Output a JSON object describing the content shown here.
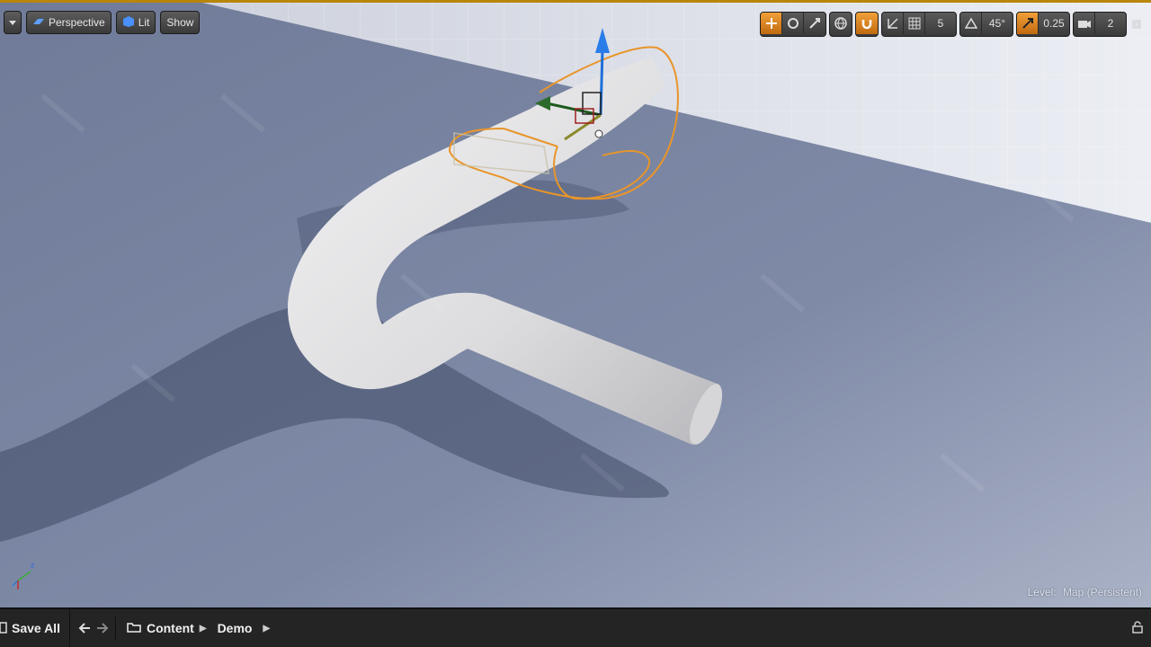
{
  "viewport": {
    "toolbar_left": {
      "menu_icon": "chevron-down-icon",
      "perspective_label": "Perspective",
      "lit_label": "Lit",
      "show_label": "Show"
    },
    "toolbar_right": {
      "grid_snap_value": "5",
      "rotation_snap_value": "45°",
      "scale_snap_value": "0.25",
      "camera_speed_value": "2"
    },
    "level_label": "Level:",
    "level_value": "Map (Persistent)"
  },
  "bottom_bar": {
    "save_all_label": "Save All",
    "breadcrumbs": [
      "Content",
      "Demo"
    ]
  },
  "colors": {
    "accent": "#e8952a",
    "floor": "#7e89a6",
    "sky": "#dfe2ec",
    "tube": "#e4e4e6"
  }
}
